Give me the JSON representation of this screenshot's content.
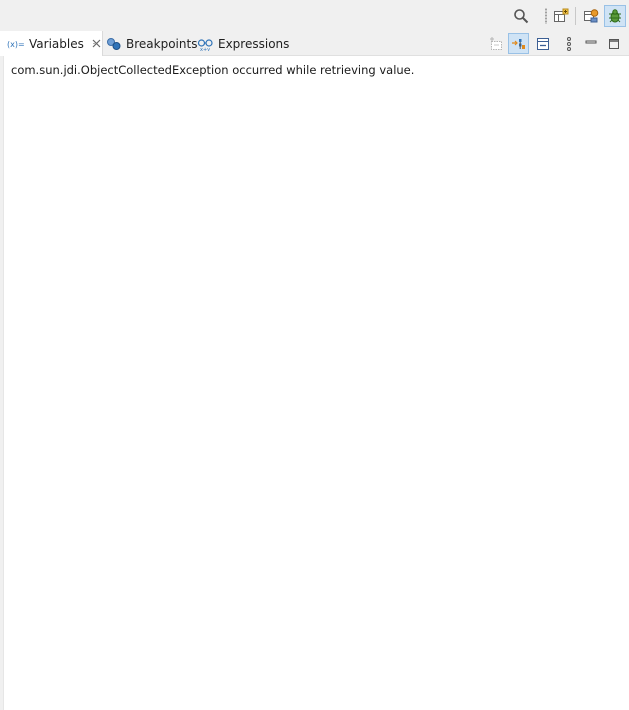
{
  "toolbar": {
    "search_icon": "search-icon",
    "open_perspective_icon": "open-perspective-icon",
    "java_perspective_icon": "java-perspective-icon",
    "debug_perspective_icon": "debug-perspective-icon"
  },
  "tabs": [
    {
      "label": "Variables",
      "icon": "variables-icon",
      "active": true
    },
    {
      "label": "Breakpoints",
      "icon": "breakpoints-icon",
      "active": false
    },
    {
      "label": "Expressions",
      "icon": "expressions-icon",
      "active": false
    }
  ],
  "view_toolbar": {
    "collapse_all_icon": "collapse-all-icon",
    "show_type_names_icon": "show-type-names-icon",
    "collapse_icon": "collapse-icon",
    "view_menu_icon": "view-menu-icon",
    "minimize_icon": "minimize-icon",
    "maximize_icon": "maximize-icon"
  },
  "content": {
    "message": "com.sun.jdi.ObjectCollectedException occurred while retrieving value."
  },
  "colors": {
    "active_button_bg": "#cfe3f5",
    "active_button_border": "#99c1e6",
    "accent_blue": "#2f73b8",
    "toolbar_bg": "#f0f0f0"
  }
}
